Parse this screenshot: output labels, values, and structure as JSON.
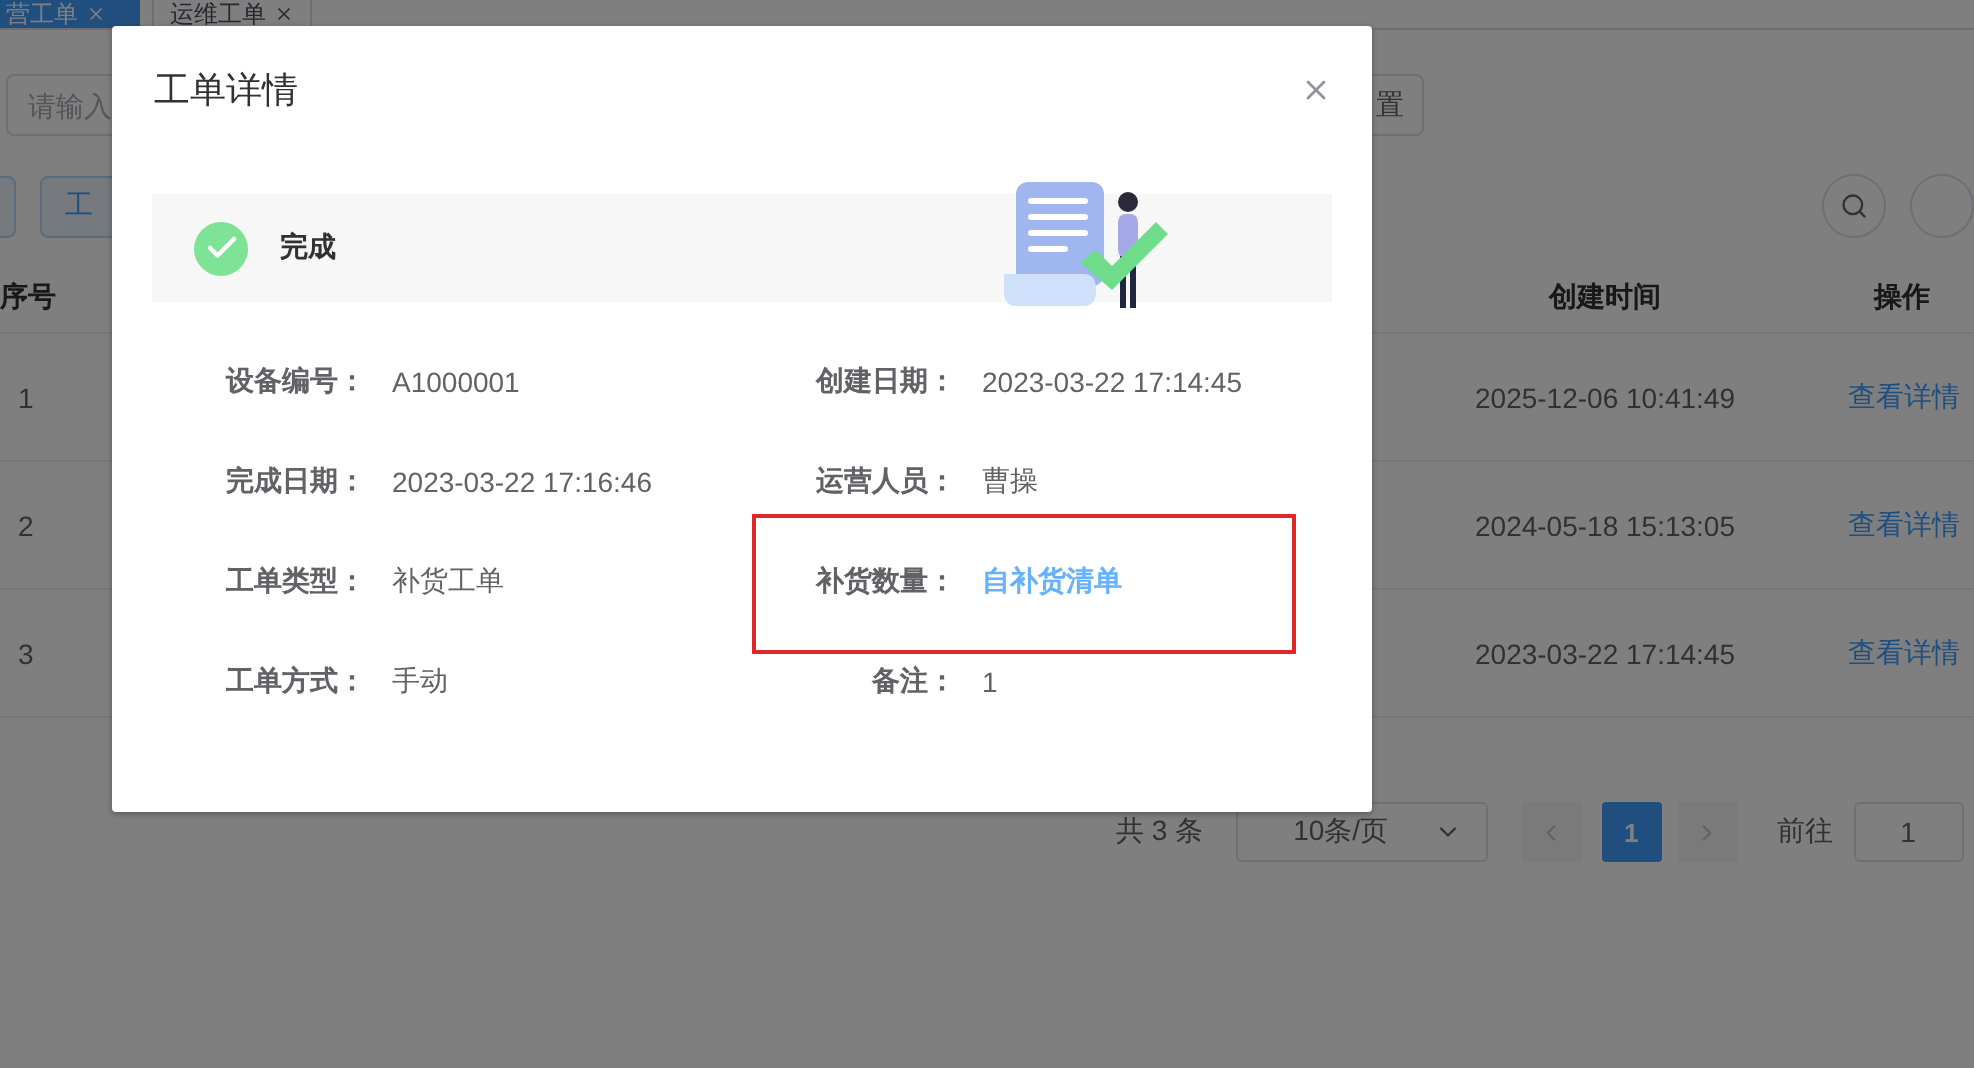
{
  "tabs": [
    {
      "label": "营工单",
      "selected": true
    },
    {
      "label": "运维工单",
      "selected": false
    }
  ],
  "search": {
    "placeholder": "请输入"
  },
  "reset_button": "置",
  "toolbar_button": "工",
  "table": {
    "columns": [
      "序号",
      "创建时间",
      "操作"
    ],
    "rows": [
      {
        "index": "1",
        "created": "2025-12-06 10:41:49",
        "action": "查看详情"
      },
      {
        "index": "2",
        "created": "2024-05-18 15:13:05",
        "action": "查看详情"
      },
      {
        "index": "3",
        "created": "2023-03-22 17:14:45",
        "action": "查看详情"
      }
    ]
  },
  "pagination": {
    "total": "共 3 条",
    "page_size": "10条/页",
    "pages": [
      {
        "label": "1",
        "selected": true
      }
    ],
    "goto_label": "前往",
    "goto_value": "1"
  },
  "dialog": {
    "title": "工单详情",
    "status": {
      "label": "完成",
      "kind": "done"
    },
    "fields": [
      {
        "label": "设备编号：",
        "value": "A1000001",
        "kind": "text",
        "highlighted": false
      },
      {
        "label": "创建日期：",
        "value": "2023-03-22 17:14:45",
        "kind": "text",
        "highlighted": false
      },
      {
        "label": "完成日期：",
        "value": "2023-03-22 17:16:46",
        "kind": "text",
        "highlighted": false
      },
      {
        "label": "运营人员：",
        "value": "曹操",
        "kind": "text",
        "highlighted": false
      },
      {
        "label": "工单类型：",
        "value": "补货工单",
        "kind": "text",
        "highlighted": false
      },
      {
        "label": "补货数量：",
        "value": "自补货清单",
        "kind": "link",
        "highlighted": true
      },
      {
        "label": "工单方式：",
        "value": "手动",
        "kind": "text",
        "highlighted": false
      },
      {
        "label": "备注：",
        "value": "1",
        "kind": "text",
        "highlighted": false
      }
    ]
  }
}
